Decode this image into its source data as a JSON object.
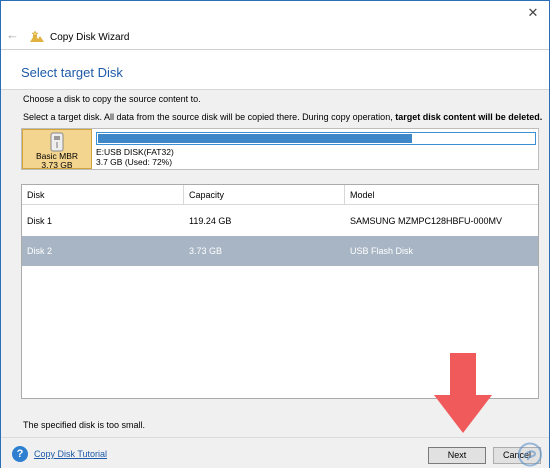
{
  "window": {
    "title": "Copy Disk Wizard",
    "close_glyph": "✕",
    "back_glyph": "←"
  },
  "header": {
    "title": "Select target Disk"
  },
  "instructions": {
    "line1": "Choose a disk to copy the source content to.",
    "line2_prefix": "Select a target disk. All data from the source disk will be copied there. During copy operation, ",
    "line2_bold": "target disk content will be deleted."
  },
  "disk_strip": {
    "disk_type": "Basic MBR",
    "disk_size": "3.73 GB",
    "partition_name": "E:USB DISK(FAT32)",
    "partition_info": "3.7 GB (Used: 72%)",
    "used_fraction": 0.72
  },
  "table": {
    "columns": [
      "Disk",
      "Capacity",
      "Model"
    ],
    "rows": [
      {
        "disk": "Disk 1",
        "capacity": "119.24 GB",
        "model": "SAMSUNG MZMPC128HBFU-000MV",
        "selected": false
      },
      {
        "disk": "Disk 2",
        "capacity": "3.73 GB",
        "model": "USB Flash Disk",
        "selected": true
      }
    ]
  },
  "status": {
    "message": "The specified disk is too small."
  },
  "footer": {
    "help_glyph": "?",
    "tutorial_link": "Copy Disk Tutorial",
    "next_label": "Next",
    "cancel_label": "Cancel"
  },
  "colors": {
    "accent": "#1e5aa8",
    "selected_row": "#a8b5c4",
    "annotation_arrow": "#f05a5a",
    "disk_box": "#f4d58f"
  },
  "icons": {
    "back": "back-arrow-icon",
    "app": "wizard-icon",
    "close": "close-icon",
    "usb": "usb-drive-icon",
    "help": "help-icon",
    "annotation": "red-down-arrow-icon"
  }
}
